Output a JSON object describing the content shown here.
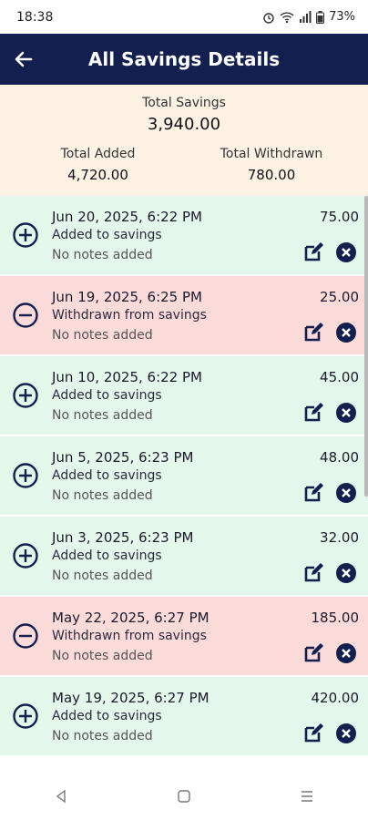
{
  "status": {
    "time": "18:38",
    "battery": "73%"
  },
  "header": {
    "title": "All Savings Details"
  },
  "summary": {
    "total_savings_label": "Total Savings",
    "total_savings": "3,940.00",
    "total_added_label": "Total Added",
    "total_added": "4,720.00",
    "total_withdrawn_label": "Total Withdrawn",
    "total_withdrawn": "780.00"
  },
  "colors": {
    "appbar": "#13204f",
    "added_bg": "#e3f8ea",
    "withdrawn_bg": "#fbdada",
    "summary_bg": "#fdf2e4"
  },
  "items": [
    {
      "type": "add",
      "date": "Jun 20, 2025, 6:22 PM",
      "desc": "Added to savings",
      "note": "No notes added",
      "amount": "75.00"
    },
    {
      "type": "withdraw",
      "date": "Jun 19, 2025, 6:25 PM",
      "desc": "Withdrawn from savings",
      "note": "No notes added",
      "amount": "25.00"
    },
    {
      "type": "add",
      "date": "Jun 10, 2025, 6:22 PM",
      "desc": "Added to savings",
      "note": "No notes added",
      "amount": "45.00"
    },
    {
      "type": "add",
      "date": "Jun 5, 2025, 6:23 PM",
      "desc": "Added to savings",
      "note": "No notes added",
      "amount": "48.00"
    },
    {
      "type": "add",
      "date": "Jun 3, 2025, 6:23 PM",
      "desc": "Added to savings",
      "note": "No notes added",
      "amount": "32.00"
    },
    {
      "type": "withdraw",
      "date": "May 22, 2025, 6:27 PM",
      "desc": "Withdrawn from savings",
      "note": "No notes added",
      "amount": "185.00"
    },
    {
      "type": "add",
      "date": "May 19, 2025, 6:27 PM",
      "desc": "Added to savings",
      "note": "No notes added",
      "amount": "420.00"
    }
  ]
}
